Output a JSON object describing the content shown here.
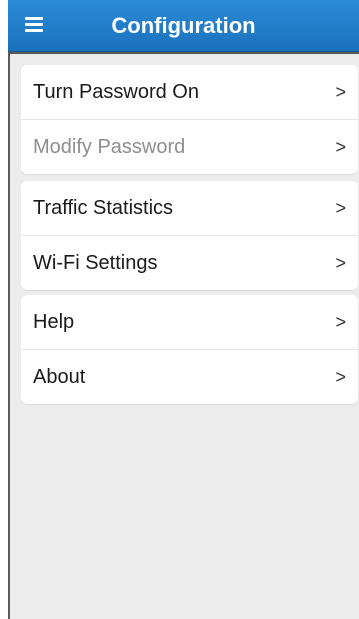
{
  "header": {
    "title": "Configuration",
    "menu_icon": "hamburger-menu-icon",
    "background_color": "#1f7ac6"
  },
  "groups": [
    {
      "items": [
        {
          "label": "Turn Password On",
          "chevron": ">",
          "enabled": true
        },
        {
          "label": "Modify Password",
          "chevron": ">",
          "enabled": false
        }
      ]
    },
    {
      "items": [
        {
          "label": "Traffic Statistics",
          "chevron": ">",
          "enabled": true
        },
        {
          "label": "Wi-Fi Settings",
          "chevron": ">",
          "enabled": true
        }
      ]
    },
    {
      "items": [
        {
          "label": "Help",
          "chevron": ">",
          "enabled": true
        },
        {
          "label": "About",
          "chevron": ">",
          "enabled": true
        }
      ]
    }
  ]
}
